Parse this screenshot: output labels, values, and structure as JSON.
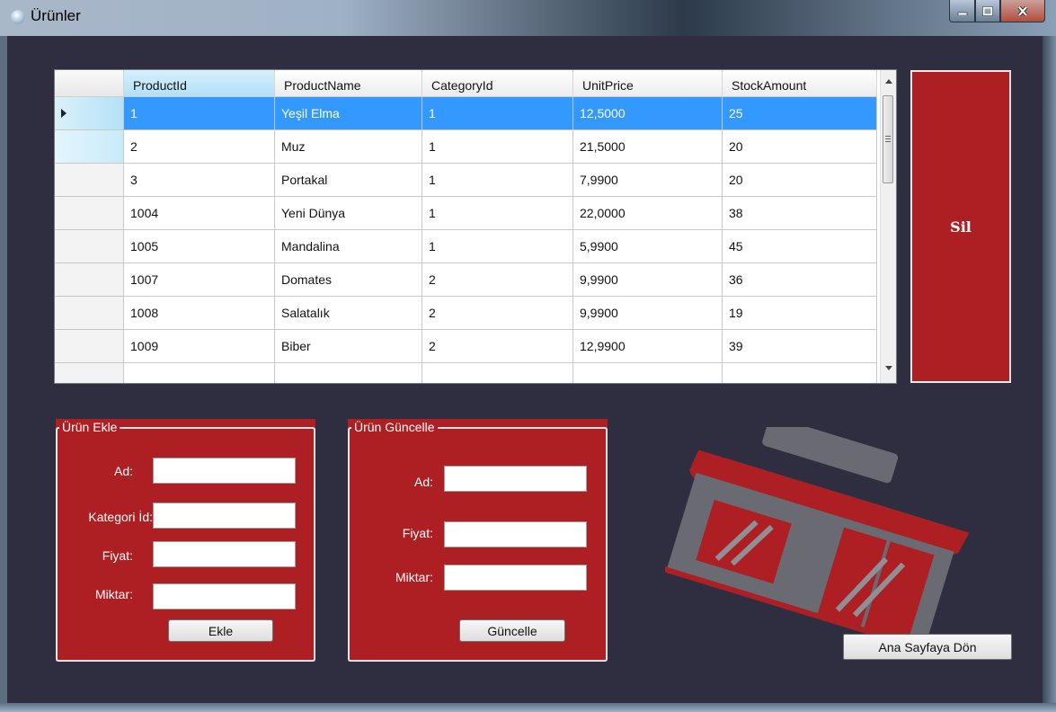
{
  "window": {
    "title": "Ürünler",
    "min_icon": "minimize-icon",
    "max_icon": "maximize-icon",
    "close_icon": "close-icon",
    "app_icon": "cart-icon"
  },
  "grid": {
    "columns": [
      "ProductId",
      "ProductName",
      "CategoryId",
      "UnitPrice",
      "StockAmount"
    ],
    "rows": [
      [
        "1",
        "Yeşil Elma",
        "1",
        "12,5000",
        "25"
      ],
      [
        "2",
        "Muz",
        "1",
        "21,5000",
        "20"
      ],
      [
        "3",
        "Portakal",
        "1",
        "7,9900",
        "20"
      ],
      [
        "1004",
        "Yeni Dünya",
        "1",
        "22,0000",
        "38"
      ],
      [
        "1005",
        "Mandalina",
        "1",
        "5,9900",
        "45"
      ],
      [
        "1007",
        "Domates",
        "2",
        "9,9900",
        "36"
      ],
      [
        "1008",
        "Salatalık",
        "2",
        "9,9900",
        "19"
      ],
      [
        "1009",
        "Biber",
        "2",
        "12,9900",
        "39"
      ]
    ],
    "selected_row": 0
  },
  "delete_button": {
    "label": "Sil",
    "color": "#ae1f24"
  },
  "add_group": {
    "legend": "Ürün Ekle",
    "name_label": "Ad:",
    "category_label": "Kategori İd:",
    "price_label": "Fiyat:",
    "amount_label": "Miktar:",
    "name_value": "",
    "category_value": "",
    "price_value": "",
    "amount_value": "",
    "button_label": "Ekle"
  },
  "update_group": {
    "legend": "Ürün Güncelle",
    "name_label": "Ad:",
    "price_label": "Fiyat:",
    "amount_label": "Miktar:",
    "name_value": "",
    "price_value": "",
    "amount_value": "",
    "button_label": "Güncelle"
  },
  "home_button": {
    "label": "Ana Sayfaya Dön"
  },
  "colors": {
    "accent": "#ae1f24",
    "background": "#2e2e40",
    "selection": "#3399ff"
  }
}
